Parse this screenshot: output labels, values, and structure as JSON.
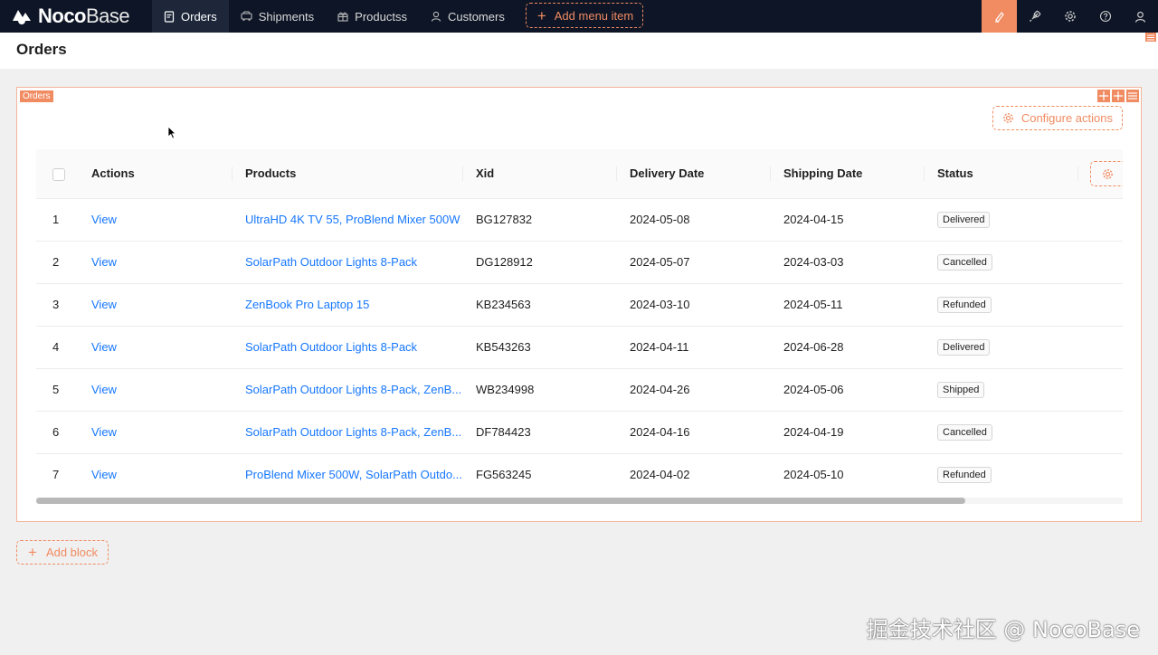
{
  "app": {
    "logo_bold": "Noco",
    "logo_light": "Base"
  },
  "nav": {
    "items": [
      {
        "label": "Orders",
        "icon": "file-icon",
        "active": true
      },
      {
        "label": "Shipments",
        "icon": "truck-icon",
        "active": false
      },
      {
        "label": "Productss",
        "icon": "gift-icon",
        "active": false
      },
      {
        "label": "Customers",
        "icon": "user-icon",
        "active": false
      }
    ],
    "add_menu_label": "Add menu item"
  },
  "page": {
    "title": "Orders"
  },
  "block": {
    "tag": "Orders",
    "configure_actions_label": "Configure actions",
    "add_block_label": "Add block"
  },
  "table": {
    "columns": [
      "Actions",
      "Products",
      "Xid",
      "Delivery Date",
      "Shipping Date",
      "Status"
    ],
    "rows": [
      {
        "index": "1",
        "action": "View",
        "products": "UltraHD 4K TV 55, ProBlend Mixer 500W",
        "xid": "BG127832",
        "delivery_date": "2024-05-08",
        "shipping_date": "2024-04-15",
        "status": "Delivered"
      },
      {
        "index": "2",
        "action": "View",
        "products": "SolarPath Outdoor Lights 8-Pack",
        "xid": "DG128912",
        "delivery_date": "2024-05-07",
        "shipping_date": "2024-03-03",
        "status": "Cancelled"
      },
      {
        "index": "3",
        "action": "View",
        "products": "ZenBook Pro Laptop 15",
        "xid": "KB234563",
        "delivery_date": "2024-03-10",
        "shipping_date": "2024-05-11",
        "status": "Refunded"
      },
      {
        "index": "4",
        "action": "View",
        "products": "SolarPath Outdoor Lights 8-Pack",
        "xid": "KB543263",
        "delivery_date": "2024-04-11",
        "shipping_date": "2024-06-28",
        "status": "Delivered"
      },
      {
        "index": "5",
        "action": "View",
        "products": "SolarPath Outdoor Lights 8-Pack, ZenB...",
        "xid": "WB234998",
        "delivery_date": "2024-04-26",
        "shipping_date": "2024-05-06",
        "status": "Shipped"
      },
      {
        "index": "6",
        "action": "View",
        "products": "SolarPath Outdoor Lights 8-Pack, ZenB...",
        "xid": "DF784423",
        "delivery_date": "2024-04-16",
        "shipping_date": "2024-04-19",
        "status": "Cancelled"
      },
      {
        "index": "7",
        "action": "View",
        "products": "ProBlend Mixer 500W, SolarPath Outdo...",
        "xid": "FG563245",
        "delivery_date": "2024-04-02",
        "shipping_date": "2024-05-10",
        "status": "Refunded"
      }
    ]
  },
  "watermark": "掘金技术社区 @ NocoBase",
  "colors": {
    "accent": "#f18b62",
    "link": "#1677ff",
    "topbar": "#0d1526"
  }
}
